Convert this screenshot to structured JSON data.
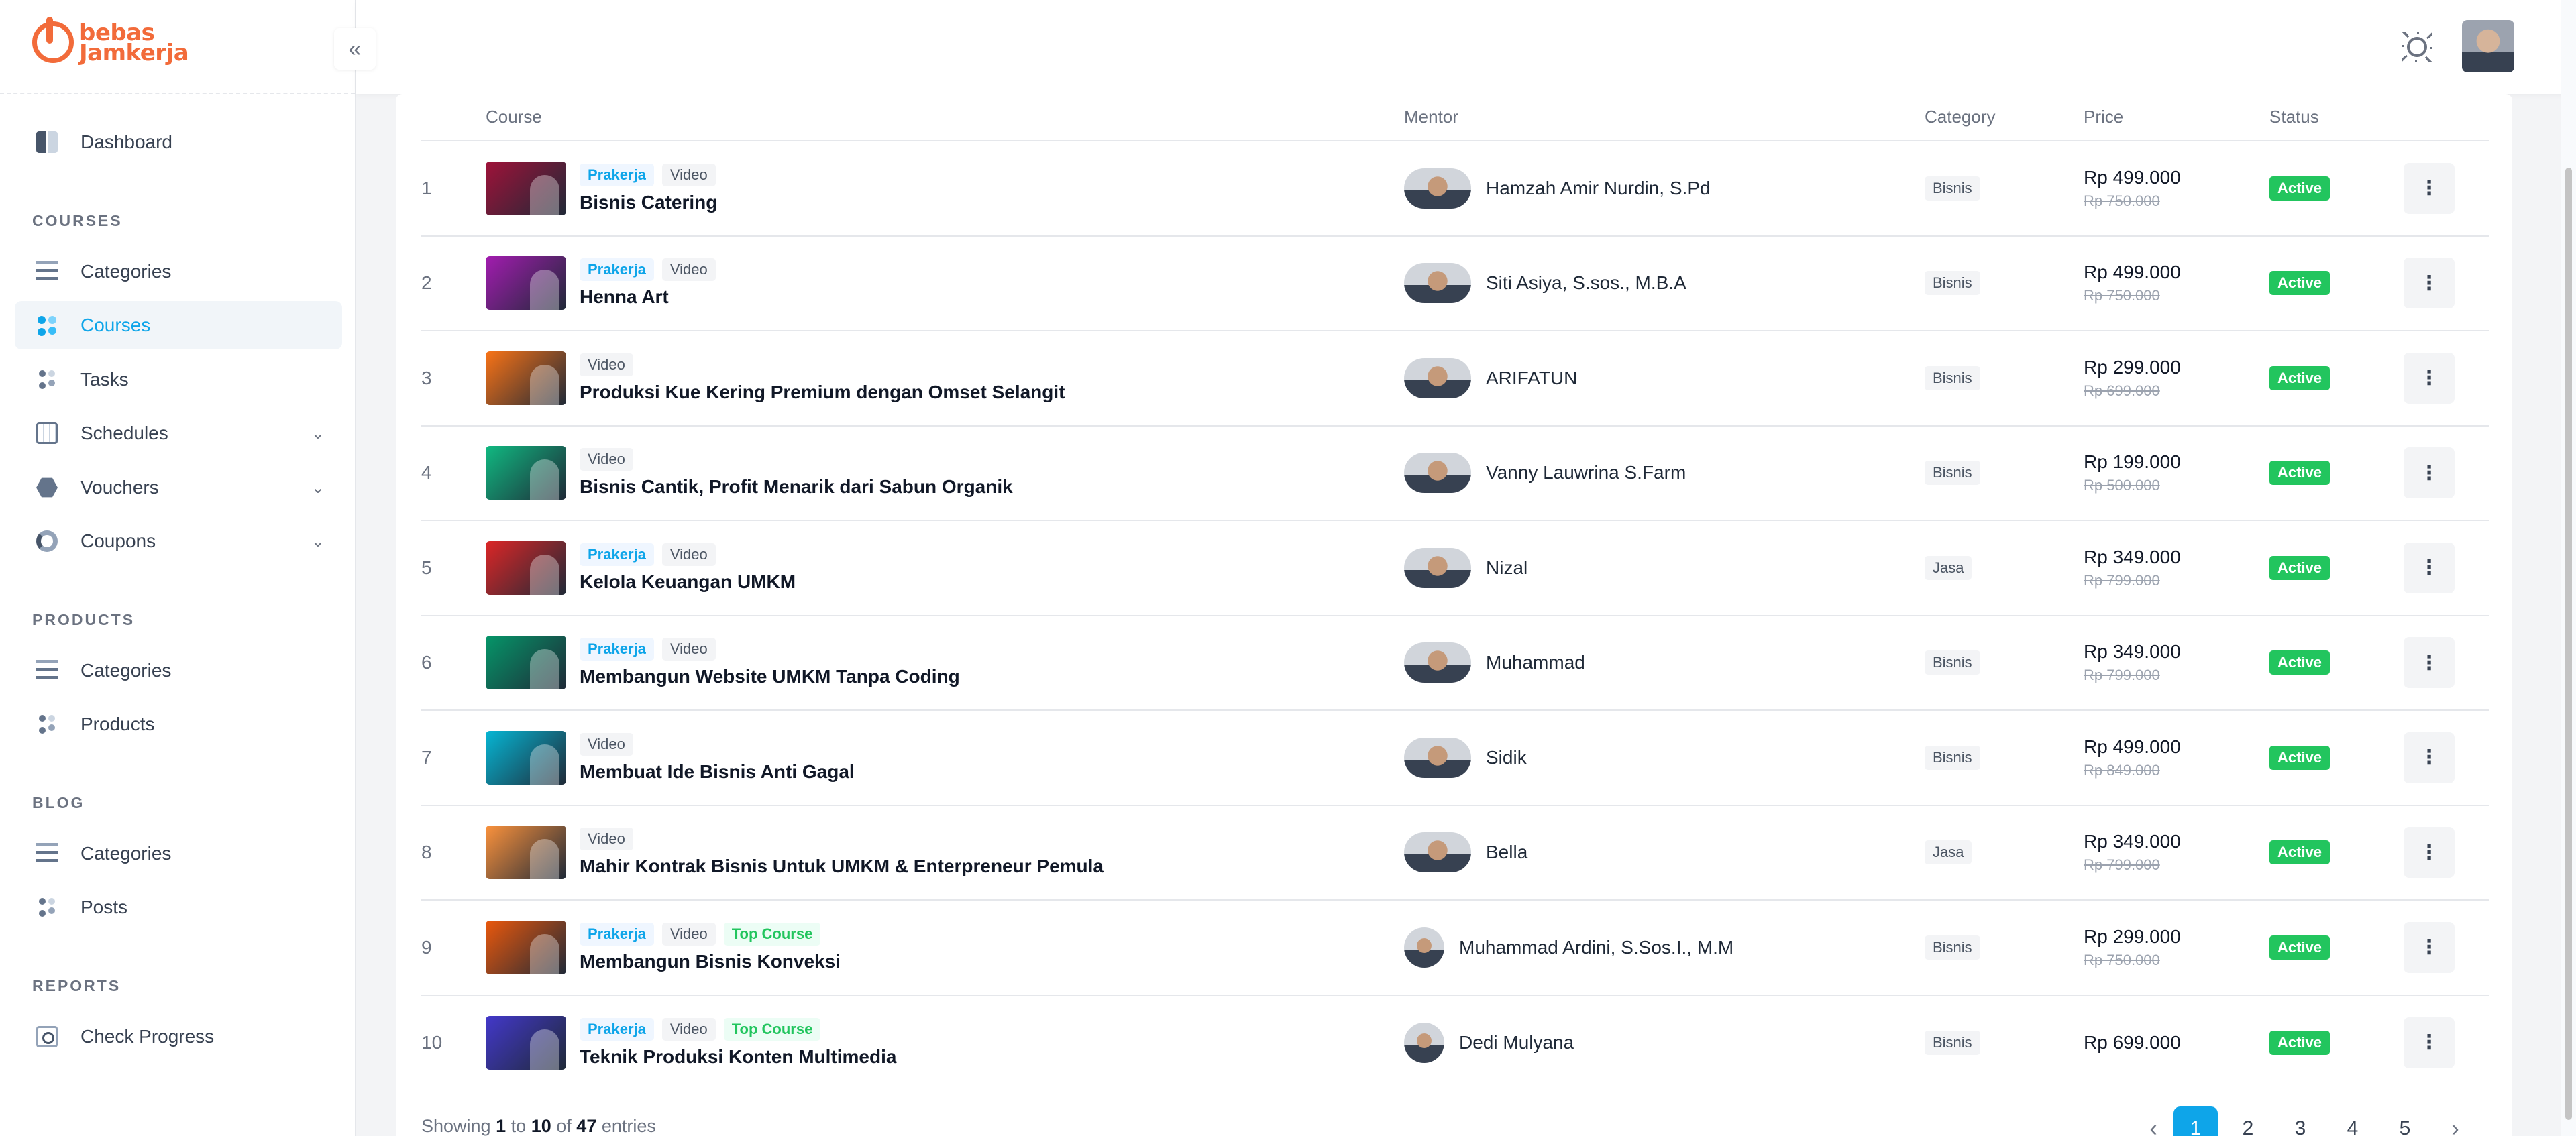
{
  "brand": {
    "line1": "bebas",
    "line2": "Jamkerja"
  },
  "sidebar": {
    "dashboard": "Dashboard",
    "sections": {
      "courses": "COURSES",
      "products": "PRODUCTS",
      "blog": "BLOG",
      "reports": "REPORTS"
    },
    "courses_items": [
      "Categories",
      "Courses",
      "Tasks",
      "Schedules",
      "Vouchers",
      "Coupons"
    ],
    "products_items": [
      "Categories",
      "Products"
    ],
    "blog_items": [
      "Categories",
      "Posts"
    ],
    "reports_items": [
      "Check Progress"
    ]
  },
  "table": {
    "headers": [
      "",
      "Course",
      "Mentor",
      "Category",
      "Price",
      "Status",
      ""
    ],
    "rows": [
      {
        "no": "1",
        "tags": [
          "Prakerja",
          "Video"
        ],
        "name": "Bisnis Catering",
        "mentor": "Hamzah Amir Nurdin, S.Pd",
        "category": "Bisnis",
        "price": "Rp 499.000",
        "old_price": "Rp 750.000",
        "status": "Active",
        "thumb": "#9f1239"
      },
      {
        "no": "2",
        "tags": [
          "Prakerja",
          "Video"
        ],
        "name": "Henna Art",
        "mentor": "Siti Asiya, S.sos., M.B.A",
        "category": "Bisnis",
        "price": "Rp 499.000",
        "old_price": "Rp 750.000",
        "status": "Active",
        "thumb": "#a21caf"
      },
      {
        "no": "3",
        "tags": [
          "Video"
        ],
        "name": "Produksi Kue Kering Premium dengan Omset Selangit",
        "mentor": "ARIFATUN",
        "category": "Bisnis",
        "price": "Rp 299.000",
        "old_price": "Rp 699.000",
        "status": "Active",
        "thumb": "#f97316"
      },
      {
        "no": "4",
        "tags": [
          "Video"
        ],
        "name": "Bisnis Cantik, Profit Menarik dari Sabun Organik",
        "mentor": "Vanny Lauwrina S.Farm",
        "category": "Bisnis",
        "price": "Rp 199.000",
        "old_price": "Rp 500.000",
        "status": "Active",
        "thumb": "#10b981"
      },
      {
        "no": "5",
        "tags": [
          "Prakerja",
          "Video"
        ],
        "name": "Kelola Keuangan UMKM",
        "mentor": "Nizal",
        "category": "Jasa",
        "price": "Rp 349.000",
        "old_price": "Rp 799.000",
        "status": "Active",
        "thumb": "#dc2626"
      },
      {
        "no": "6",
        "tags": [
          "Prakerja",
          "Video"
        ],
        "name": "Membangun Website UMKM Tanpa Coding",
        "mentor": "Muhammad",
        "category": "Bisnis",
        "price": "Rp 349.000",
        "old_price": "Rp 799.000",
        "status": "Active",
        "thumb": "#059669"
      },
      {
        "no": "7",
        "tags": [
          "Video"
        ],
        "name": "Membuat Ide Bisnis Anti Gagal",
        "mentor": "Sidik",
        "category": "Bisnis",
        "price": "Rp 499.000",
        "old_price": "Rp 849.000",
        "status": "Active",
        "thumb": "#06b6d4"
      },
      {
        "no": "8",
        "tags": [
          "Video"
        ],
        "name": "Mahir Kontrak Bisnis Untuk UMKM & Enterpreneur Pemula",
        "mentor": "Bella",
        "category": "Jasa",
        "price": "Rp 349.000",
        "old_price": "Rp 799.000",
        "status": "Active",
        "thumb": "#fb923c"
      },
      {
        "no": "9",
        "tags": [
          "Prakerja",
          "Video",
          "Top Course"
        ],
        "name": "Membangun Bisnis Konveksi",
        "mentor": "Muhammad Ardini, S.Sos.I., M.M",
        "category": "Bisnis",
        "price": "Rp 299.000",
        "old_price": "Rp 750.000",
        "status": "Active",
        "thumb": "#ea580c"
      },
      {
        "no": "10",
        "tags": [
          "Prakerja",
          "Video",
          "Top Course"
        ],
        "name": "Teknik Produksi Konten Multimedia",
        "mentor": "Dedi Mulyana",
        "category": "Bisnis",
        "price": "Rp 699.000",
        "old_price": "",
        "status": "Active",
        "thumb": "#4338ca"
      }
    ]
  },
  "footer": {
    "showing_prefix": "Showing",
    "from": "1",
    "to_word": "to",
    "to": "10",
    "of_word": "of",
    "total": "47",
    "suffix": "entries"
  },
  "pagination": {
    "pages": [
      "1",
      "2",
      "3",
      "4",
      "5"
    ],
    "current": "1",
    "prev": "‹",
    "next": "›"
  },
  "icons": {
    "collapse": "«",
    "theme": "sun-icon",
    "kebab": "⋮",
    "chevron": "⌄"
  }
}
